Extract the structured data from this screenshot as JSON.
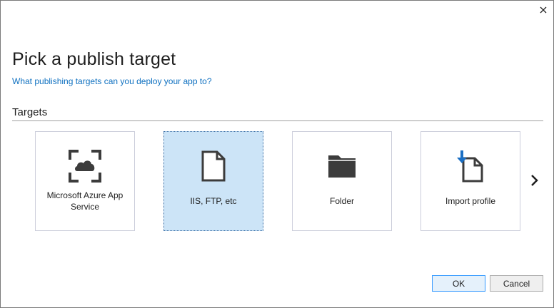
{
  "dialog": {
    "title": "Pick a publish target",
    "subtitle": "What publishing targets can you deploy your app to?"
  },
  "targets": {
    "header": "Targets",
    "cards": [
      {
        "label": "Microsoft Azure App Service",
        "icon": "azure-app-service-icon",
        "selected": false
      },
      {
        "label": "IIS, FTP, etc",
        "icon": "document-icon",
        "selected": true
      },
      {
        "label": "Folder",
        "icon": "folder-icon",
        "selected": false
      },
      {
        "label": "Import profile",
        "icon": "import-profile-icon",
        "selected": false
      }
    ],
    "next_icon": "chevron-right-icon"
  },
  "buttons": {
    "ok": "OK",
    "cancel": "Cancel"
  },
  "colors": {
    "link": "#0e70c0",
    "selected_card": "#cce4f7",
    "icon_dark": "#3c3c3c",
    "import_arrow": "#1a6fc4"
  }
}
